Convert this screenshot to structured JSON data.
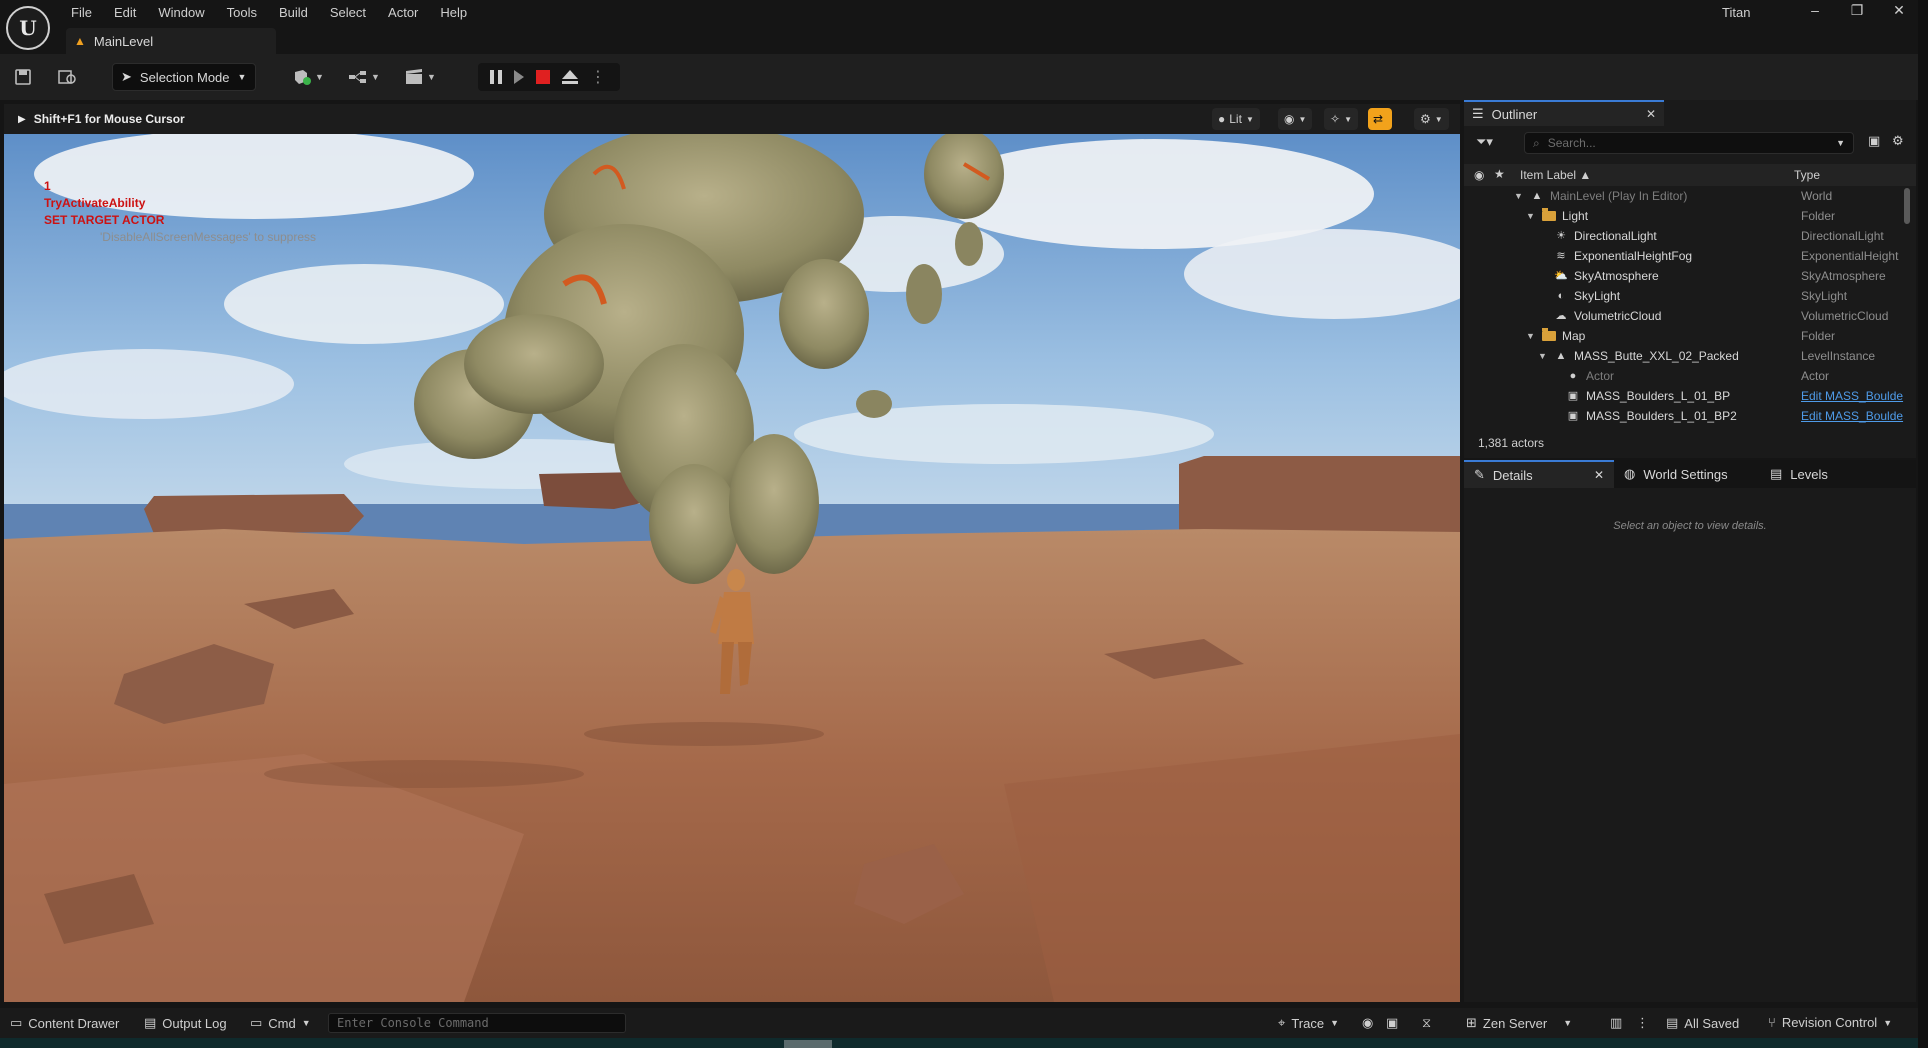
{
  "app": {
    "logo_glyph": "U",
    "menu": [
      "File",
      "Edit",
      "Window",
      "Tools",
      "Build",
      "Select",
      "Actor",
      "Help"
    ],
    "level_tab": "MainLevel",
    "user": "Titan",
    "window_controls": [
      "–",
      "❐",
      "✕"
    ]
  },
  "toolbar": {
    "selection_mode": "Selection Mode"
  },
  "viewport": {
    "hint": "Shift+F1 for Mouse Cursor",
    "view_mode": "Lit",
    "debug_lines": [
      "1",
      "TryActivateAbility",
      "SET TARGET ACTOR"
    ],
    "debug_suppress": "'DisableAllScreenMessages' to suppress"
  },
  "outliner": {
    "tab": "Outliner",
    "search_placeholder": "Search...",
    "col_label": "Item Label",
    "col_type": "Type",
    "actor_count": "1,381 actors",
    "rows": [
      {
        "label": "MainLevel (Play In Editor)",
        "type": "World",
        "depth": 0,
        "kind": "world"
      },
      {
        "label": "Light",
        "type": "Folder",
        "depth": 1,
        "kind": "folder"
      },
      {
        "label": "DirectionalLight",
        "type": "DirectionalLight",
        "depth": 2,
        "kind": "sun"
      },
      {
        "label": "ExponentialHeightFog",
        "type": "ExponentialHeight",
        "depth": 2,
        "kind": "fog"
      },
      {
        "label": "SkyAtmosphere",
        "type": "SkyAtmosphere",
        "depth": 2,
        "kind": "sky"
      },
      {
        "label": "SkyLight",
        "type": "SkyLight",
        "depth": 2,
        "kind": "skylight"
      },
      {
        "label": "VolumetricCloud",
        "type": "VolumetricCloud",
        "depth": 2,
        "kind": "cloud"
      },
      {
        "label": "Map",
        "type": "Folder",
        "depth": 1,
        "kind": "folder"
      },
      {
        "label": "MASS_Butte_XXL_02_Packed",
        "type": "LevelInstance",
        "depth": 2,
        "kind": "level"
      },
      {
        "label": "Actor",
        "type": "Actor",
        "depth": 3,
        "kind": "actor"
      },
      {
        "label": "MASS_Boulders_L_01_BP",
        "type": "Edit MASS_Boulde",
        "depth": 3,
        "kind": "bp"
      },
      {
        "label": "MASS_Boulders_L_01_BP2",
        "type": "Edit MASS_Boulde",
        "depth": 3,
        "kind": "bp"
      }
    ]
  },
  "details": {
    "tabs": [
      "Details",
      "World Settings",
      "Levels"
    ],
    "empty_message": "Select an object to view details."
  },
  "statusbar": {
    "content_drawer": "Content Drawer",
    "output_log": "Output Log",
    "cmd": "Cmd",
    "console_placeholder": "Enter Console Command",
    "trace": "Trace",
    "zen_server": "Zen Server",
    "all_saved": "All Saved",
    "revision_control": "Revision Control"
  }
}
